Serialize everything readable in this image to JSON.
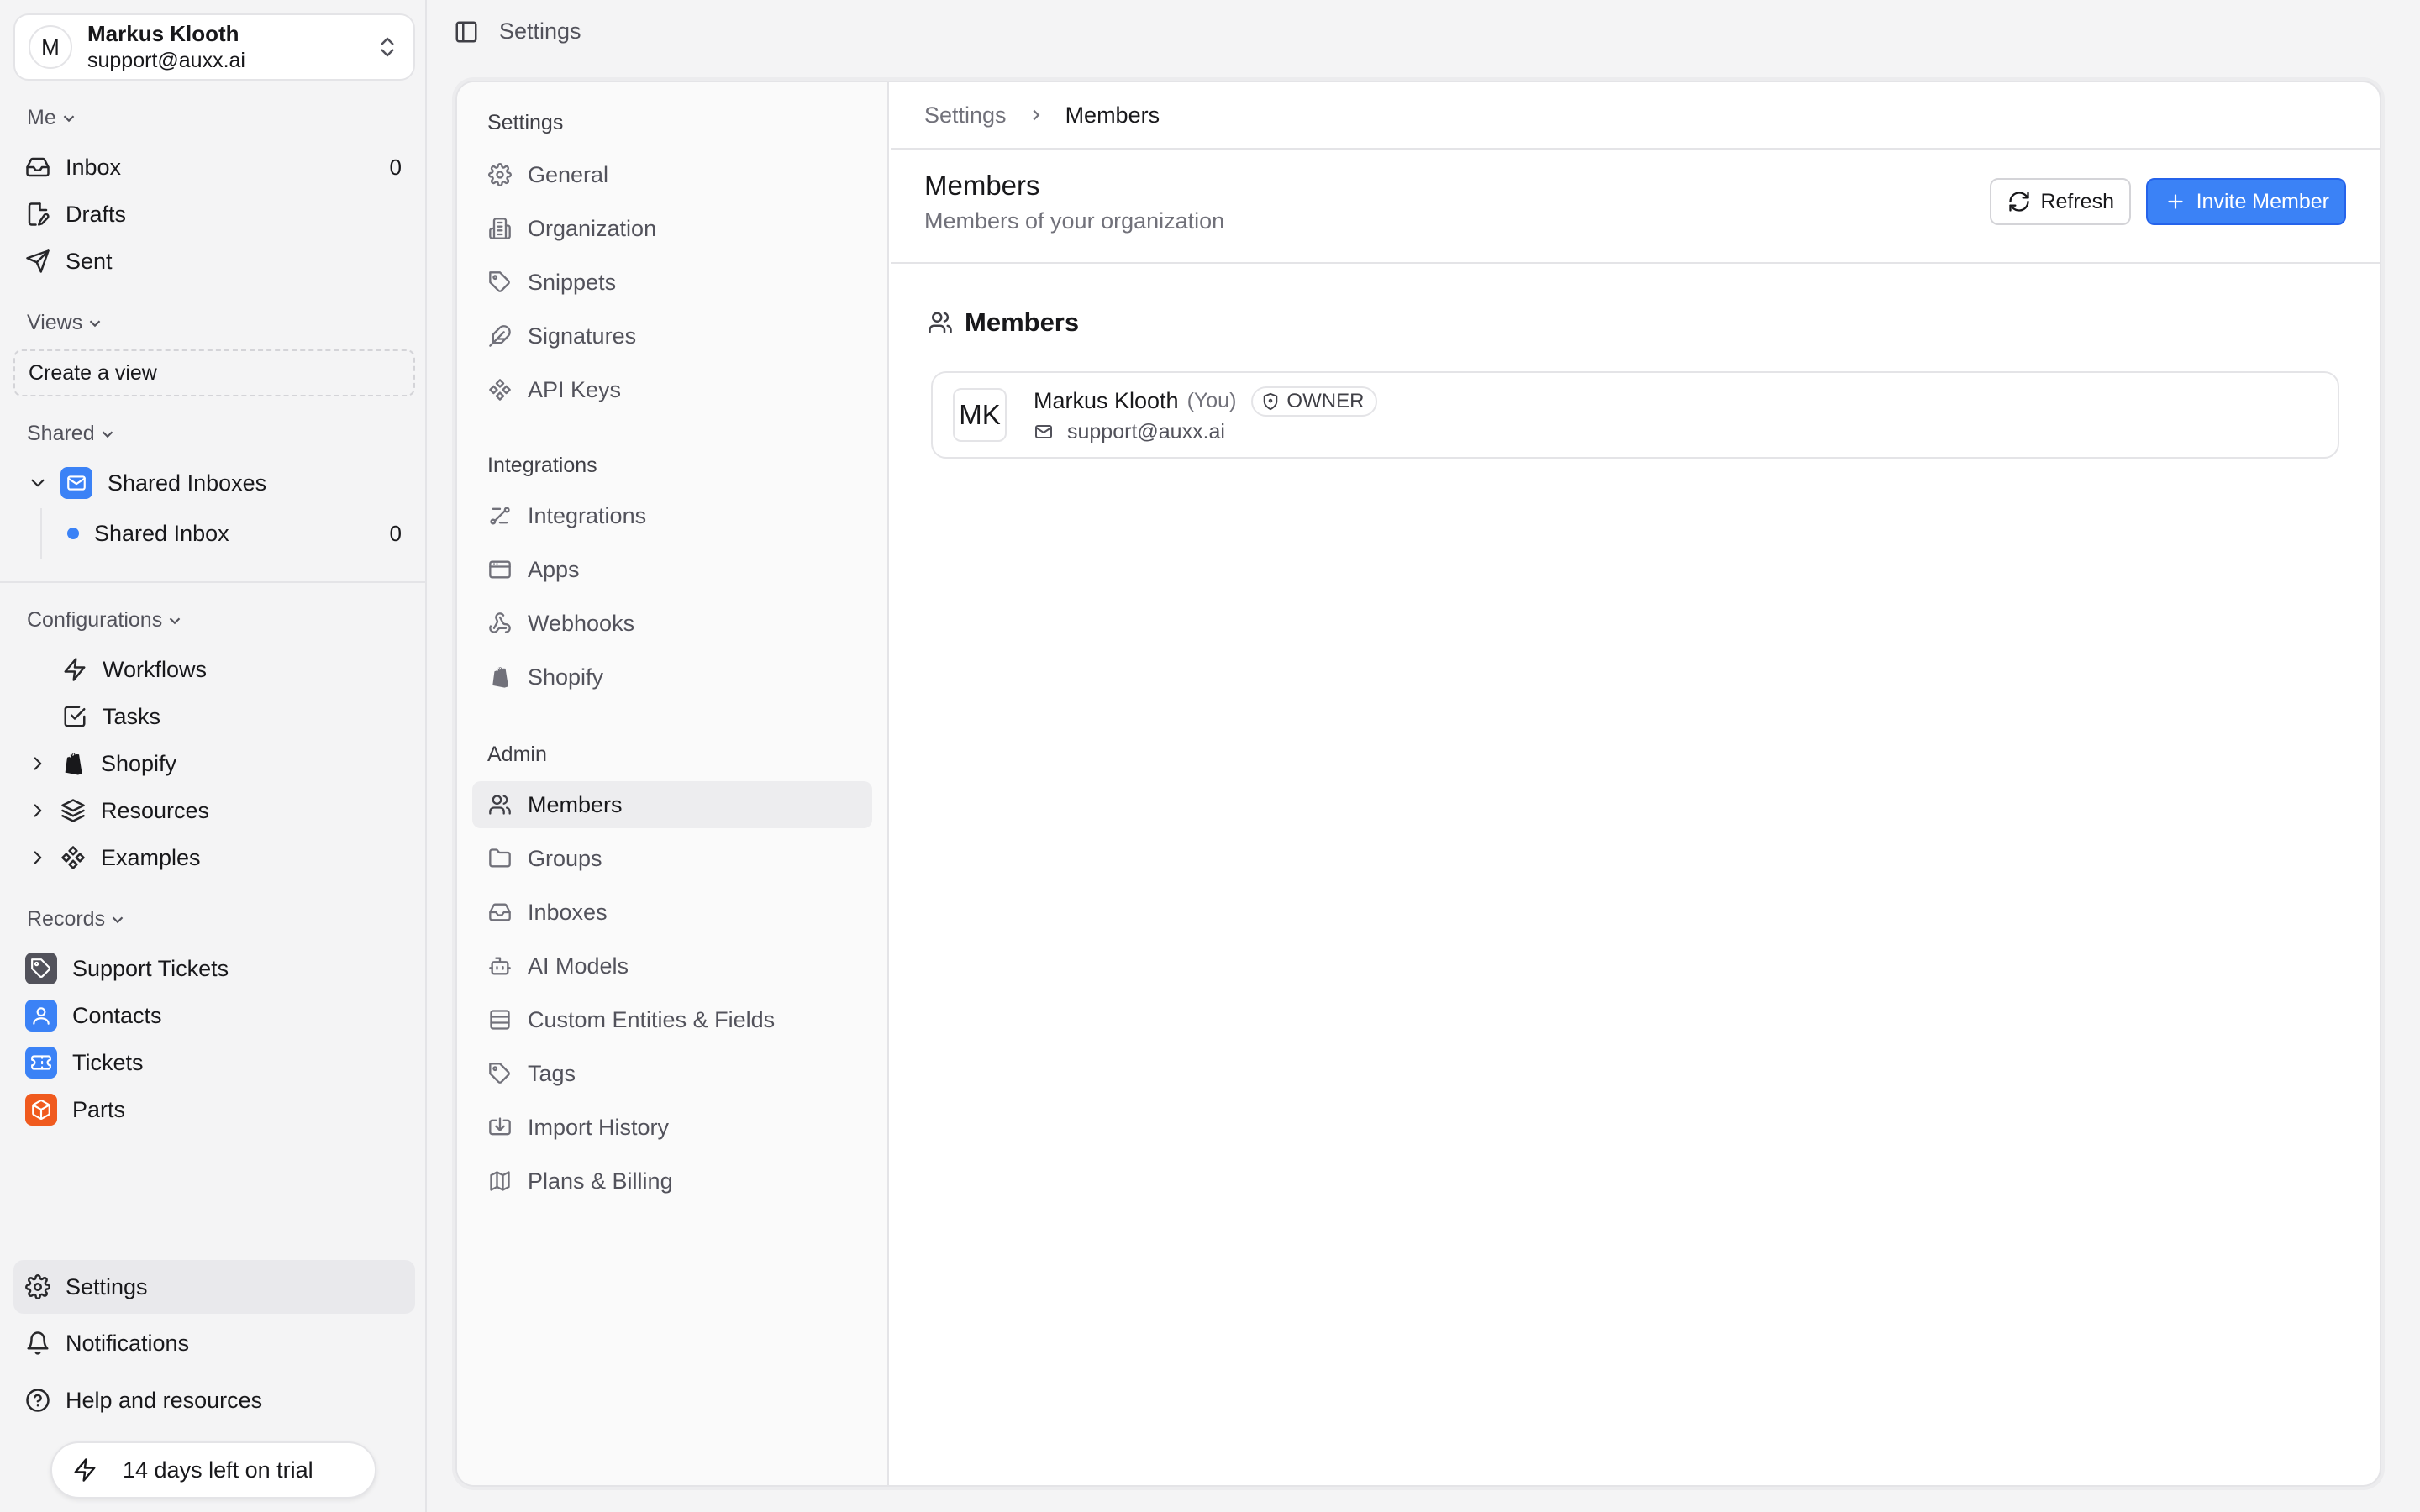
{
  "user": {
    "initial": "M",
    "name": "Markus Klooth",
    "email": "support@auxx.ai"
  },
  "sidebar": {
    "me_label": "Me",
    "inbox_label": "Inbox",
    "inbox_count": "0",
    "drafts_label": "Drafts",
    "sent_label": "Sent",
    "views_label": "Views",
    "create_view_label": "Create a view",
    "shared_label": "Shared",
    "shared_inboxes_label": "Shared Inboxes",
    "shared_inbox_label": "Shared Inbox",
    "shared_inbox_count": "0",
    "configurations_label": "Configurations",
    "workflows_label": "Workflows",
    "tasks_label": "Tasks",
    "shopify_label": "Shopify",
    "resources_label": "Resources",
    "examples_label": "Examples",
    "records_label": "Records",
    "support_tickets_label": "Support Tickets",
    "contacts_label": "Contacts",
    "tickets_label": "Tickets",
    "parts_label": "Parts",
    "settings_label": "Settings",
    "notifications_label": "Notifications",
    "help_label": "Help and resources",
    "trial_label": "14 days left on trial"
  },
  "topbar": {
    "title": "Settings"
  },
  "settings_nav": {
    "group_settings": "Settings",
    "general": "General",
    "organization": "Organization",
    "snippets": "Snippets",
    "signatures": "Signatures",
    "api_keys": "API Keys",
    "group_integrations": "Integrations",
    "integrations": "Integrations",
    "apps": "Apps",
    "webhooks": "Webhooks",
    "shopify": "Shopify",
    "group_admin": "Admin",
    "members": "Members",
    "groups": "Groups",
    "inboxes": "Inboxes",
    "ai_models": "AI Models",
    "custom_entities": "Custom Entities & Fields",
    "tags": "Tags",
    "import_history": "Import History",
    "plans_billing": "Plans & Billing"
  },
  "content": {
    "breadcrumb_root": "Settings",
    "breadcrumb_current": "Members",
    "title": "Members",
    "subtitle": "Members of your organization",
    "refresh_label": "Refresh",
    "invite_label": "Invite Member",
    "members_heading": "Members",
    "member": {
      "initials": "MK",
      "name": "Markus Klooth",
      "you": "(You)",
      "role": "OWNER",
      "email": "support@auxx.ai"
    }
  },
  "colors": {
    "accent": "#3b82f6",
    "support_tickets": "#52525b",
    "contacts": "#3b82f6",
    "tickets": "#3b82f6",
    "parts": "#f05a1e"
  }
}
